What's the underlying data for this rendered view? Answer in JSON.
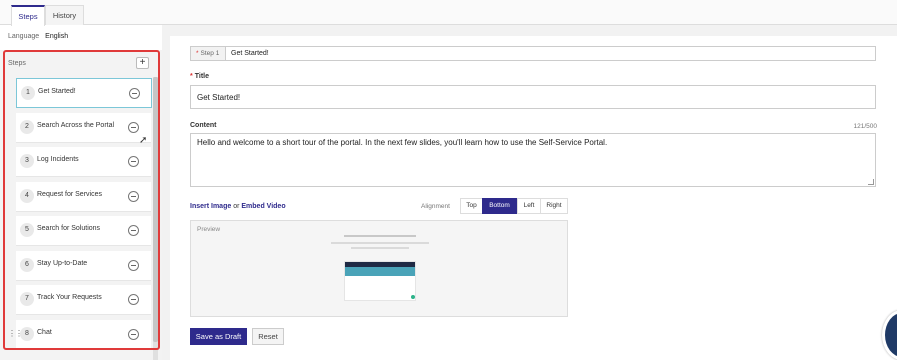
{
  "tabs": [
    {
      "label": "Steps",
      "active": true
    },
    {
      "label": "History",
      "active": false
    }
  ],
  "language": {
    "label": "Language",
    "value": "English"
  },
  "sidebar": {
    "header": "Steps",
    "add_label": "+",
    "steps": [
      {
        "num": "1",
        "label": "Get Started!"
      },
      {
        "num": "2",
        "label": "Search Across the Portal"
      },
      {
        "num": "3",
        "label": "Log Incidents"
      },
      {
        "num": "4",
        "label": "Request for Services"
      },
      {
        "num": "5",
        "label": "Search for Solutions"
      },
      {
        "num": "6",
        "label": "Stay Up-to-Date"
      },
      {
        "num": "7",
        "label": "Track Your Requests"
      },
      {
        "num": "8",
        "label": "Chat"
      }
    ]
  },
  "editor": {
    "step_tag": "Step 1",
    "step_name": "Get Started!",
    "title_label": "Title",
    "title_value": "Get Started!",
    "content_label": "Content",
    "content_counter": "121/500",
    "content_value": "Hello and welcome to a short tour of the portal. In the next few slides, you'll learn how to use the Self-Service Portal.",
    "insert_image": "Insert Image",
    "or": "or",
    "embed_video": "Embed Video",
    "alignment_label": "Alignment",
    "alignment_options": [
      "Top",
      "Bottom",
      "Left",
      "Right"
    ],
    "alignment_selected": "Bottom",
    "preview_label": "Preview",
    "save_label": "Save as Draft",
    "reset_label": "Reset"
  },
  "colors": {
    "accent": "#2e2a8c",
    "highlight_border": "#e03a3a",
    "active_step_border": "#7cc7d8"
  }
}
